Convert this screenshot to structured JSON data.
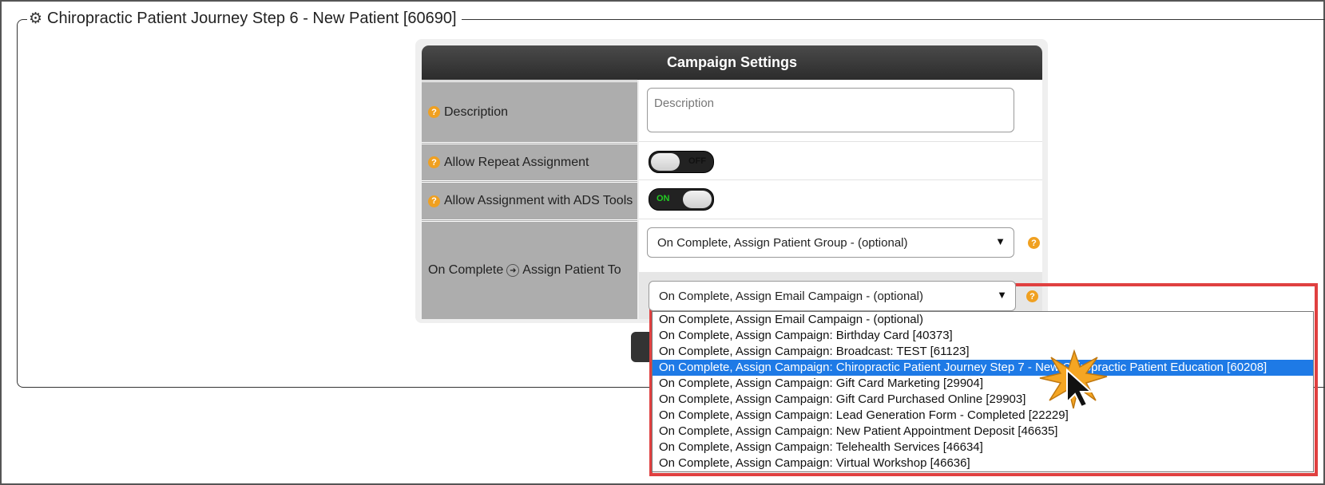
{
  "page": {
    "title": "Chiropractic Patient Journey Step 6 - New Patient [60690]",
    "title_icon": "gear-icon"
  },
  "panel": {
    "header": "Campaign Settings",
    "description": {
      "label": "Description",
      "placeholder": "Description"
    },
    "repeat": {
      "label": "Allow Repeat Assignment",
      "state": "OFF"
    },
    "ads": {
      "label": "Allow Assignment with ADS Tools",
      "state": "ON"
    },
    "on_complete": {
      "label_prefix": "On Complete",
      "label_suffix": "Assign Patient To",
      "arrow_icon": "arrow-circle-right-icon",
      "group_select": "On Complete, Assign Patient Group - (optional)",
      "email_select": "On Complete, Assign Email Campaign - (optional)"
    }
  },
  "dropdown": {
    "selected_index": 3,
    "options": [
      "On Complete, Assign Email Campaign - (optional)",
      "On Complete, Assign Campaign: Birthday Card [40373]",
      "On Complete, Assign Campaign: Broadcast: TEST [61123]",
      "On Complete, Assign Campaign: Chiropractic Patient Journey Step 7 - New Chiropractic Patient Education [60208]",
      "On Complete, Assign Campaign: Gift Card Marketing [29904]",
      "On Complete, Assign Campaign: Gift Card Purchased Online [29903]",
      "On Complete, Assign Campaign: Lead Generation Form - Completed [22229]",
      "On Complete, Assign Campaign: New Patient Appointment Deposit [46635]",
      "On Complete, Assign Campaign: Telehealth Services [46634]",
      "On Complete, Assign Campaign: Virtual Workshop [46636]"
    ]
  },
  "colors": {
    "header_bg": "#333333",
    "label_bg": "#adadad",
    "highlight": "#1e7ae6",
    "annotation": "#e04040",
    "help_icon": "#f0a020",
    "toggle_on_text": "#22cc22"
  }
}
